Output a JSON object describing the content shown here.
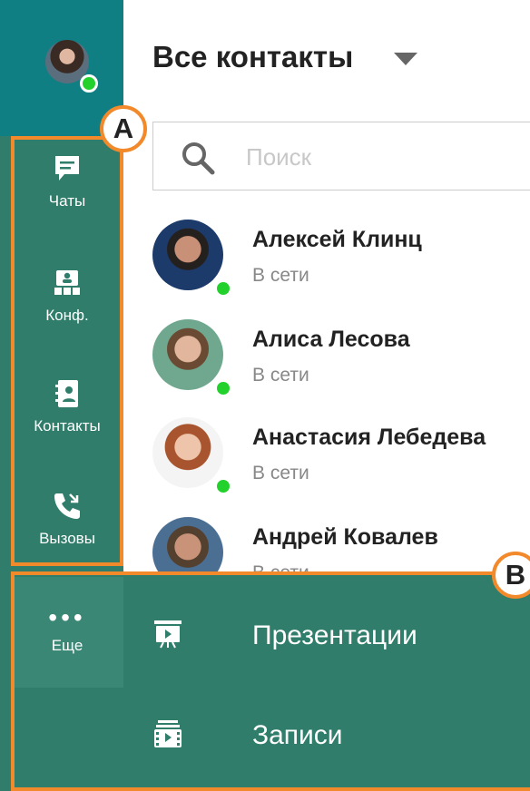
{
  "header": {
    "title": "Все контакты"
  },
  "search": {
    "placeholder": "Поиск",
    "value": ""
  },
  "sidebar": {
    "items": [
      {
        "label": "Чаты",
        "icon": "chat-icon"
      },
      {
        "label": "Конф.",
        "icon": "conference-icon"
      },
      {
        "label": "Контакты",
        "icon": "contacts-icon"
      },
      {
        "label": "Вызовы",
        "icon": "calls-icon"
      }
    ],
    "more": {
      "label": "Еще",
      "icon": "more-icon"
    }
  },
  "contacts": [
    {
      "name": "Алексей Клинц",
      "status": "В сети"
    },
    {
      "name": "Алиса Лесова",
      "status": "В сети"
    },
    {
      "name": "Анастасия Лебедева",
      "status": "В сети"
    },
    {
      "name": "Андрей Ковалев",
      "status": "В сети"
    }
  ],
  "more_menu": {
    "items": [
      {
        "label": "Презентации",
        "icon": "presentation-icon"
      },
      {
        "label": "Записи",
        "icon": "recordings-icon"
      }
    ]
  },
  "callouts": {
    "a": "A",
    "b": "B"
  },
  "colors": {
    "sidebar": "#2f7d6a",
    "sidebar_top": "#0f7f84",
    "accent": "#f2892b",
    "online": "#22d12c"
  }
}
